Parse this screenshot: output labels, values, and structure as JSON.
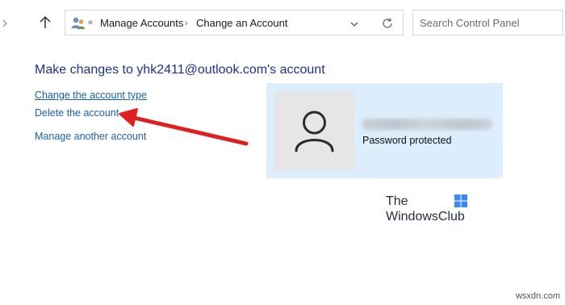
{
  "navigation": {
    "forward_icon": "chevron-right-icon",
    "up_icon": "arrow-up-icon"
  },
  "address_bar": {
    "icon": "user-accounts-icon",
    "overflow_glyph": "«",
    "breadcrumbs": [
      "Manage Accounts",
      "Change an Account"
    ],
    "separator": "›",
    "dropdown_icon": "chevron-down-icon",
    "refresh_icon": "refresh-icon"
  },
  "search": {
    "placeholder": "Search Control Panel"
  },
  "main": {
    "title": "Make changes to yhk2411@outlook.com's account",
    "links": [
      {
        "label": "Change the account type"
      },
      {
        "label": "Delete the account"
      },
      {
        "label": "Manage another account"
      }
    ]
  },
  "account_card": {
    "avatar_icon": "user-avatar-icon",
    "status": "Password protected",
    "background_color": "#dceefb"
  },
  "annotation": {
    "arrow_color": "#e02020",
    "target": "Delete the account"
  },
  "watermark": {
    "line1": "The",
    "line2": "WindowsClub"
  },
  "site_tag": "wsxdn.com",
  "colors": {
    "title": "#1e3287",
    "link": "#1a5fb4"
  }
}
